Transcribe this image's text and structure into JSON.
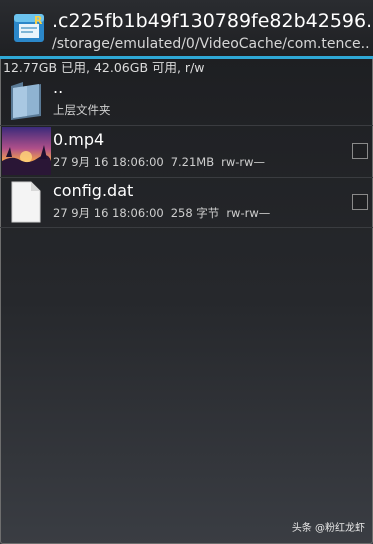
{
  "header": {
    "title": ".c225fb1b49f130789fe82b42596...",
    "path": "/storage/emulated/0/VideoCache/com.tence..."
  },
  "storage": {
    "info": "12.77GB 已用, 42.06GB 可用, r/w"
  },
  "files": [
    {
      "name": "..",
      "meta": [
        "上层文件夹"
      ],
      "icon": "folder-icon",
      "selectable": false
    },
    {
      "name": "0.mp4",
      "meta": [
        "27 9月 16 18:06:00",
        "7.21MB",
        "rw-rw—"
      ],
      "icon": "video-thumbnail",
      "selectable": true,
      "checked": false
    },
    {
      "name": "config.dat",
      "meta": [
        "27 9月 16 18:06:00",
        "258 字节",
        "rw-rw—"
      ],
      "icon": "document-icon",
      "selectable": true,
      "checked": false
    }
  ],
  "watermark": "头条 @粉红龙虾",
  "colors": {
    "accent": "#2fa8d6",
    "background": "#1c1d20"
  }
}
